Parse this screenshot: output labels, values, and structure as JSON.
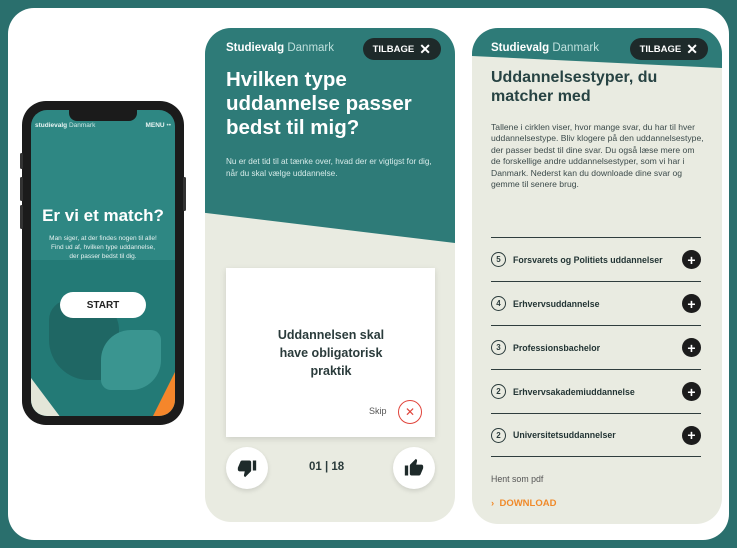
{
  "phone": {
    "brand_prefix": "studievalg",
    "brand_suffix": " Danmark",
    "menu_label": "MENU",
    "menu_dots": "••",
    "title": "Er vi et match?",
    "intro": "Man siger, at der findes nogen til alle! Find ud af, hvilken type uddannelse, der passer bedst til dig.",
    "start_label": "START"
  },
  "quiz": {
    "brand_prefix": "Studievalg",
    "brand_suffix": " Danmark",
    "back_label": "TILBAGE",
    "title": "Hvilken type uddannelse passer bedst til mig?",
    "subtitle": "Nu er det tid til at tænke over, hvad der er vigtigst for dig, når du skal vælge uddannelse.",
    "question": "Uddannelsen skal have obligatorisk praktik",
    "skip_label": "Skip",
    "counter": "01 | 18",
    "colors": {
      "teal": "#2e7b78",
      "orange": "#f08a2b",
      "skip_red": "#e0443b"
    }
  },
  "results": {
    "brand_prefix": "Studievalg",
    "brand_suffix": " Danmark",
    "back_label": "TILBAGE",
    "title": "Uddannelsestyper, du matcher med",
    "description": "Tallene i cirklen viser, hvor mange svar, du har til hver uddannelsestype. Bliv klogere på den uddannelsestype, der passer bedst til dine svar. Du også læse mere om de forskellige andre uddannelsestyper, som vi har i Danmark. Nederst kan du downloade dine svar og gemme til senere brug.",
    "items": [
      {
        "count": "5",
        "label": "Forsvarets og Politiets uddannelser"
      },
      {
        "count": "4",
        "label": "Erhvervsuddannelse"
      },
      {
        "count": "3",
        "label": "Professionsbachelor"
      },
      {
        "count": "2",
        "label": "Erhvervsakademiuddannelse"
      },
      {
        "count": "2",
        "label": "Universitetsuddannelser"
      }
    ],
    "pdf_label": "Hent som pdf",
    "download_label": "DOWNLOAD"
  }
}
